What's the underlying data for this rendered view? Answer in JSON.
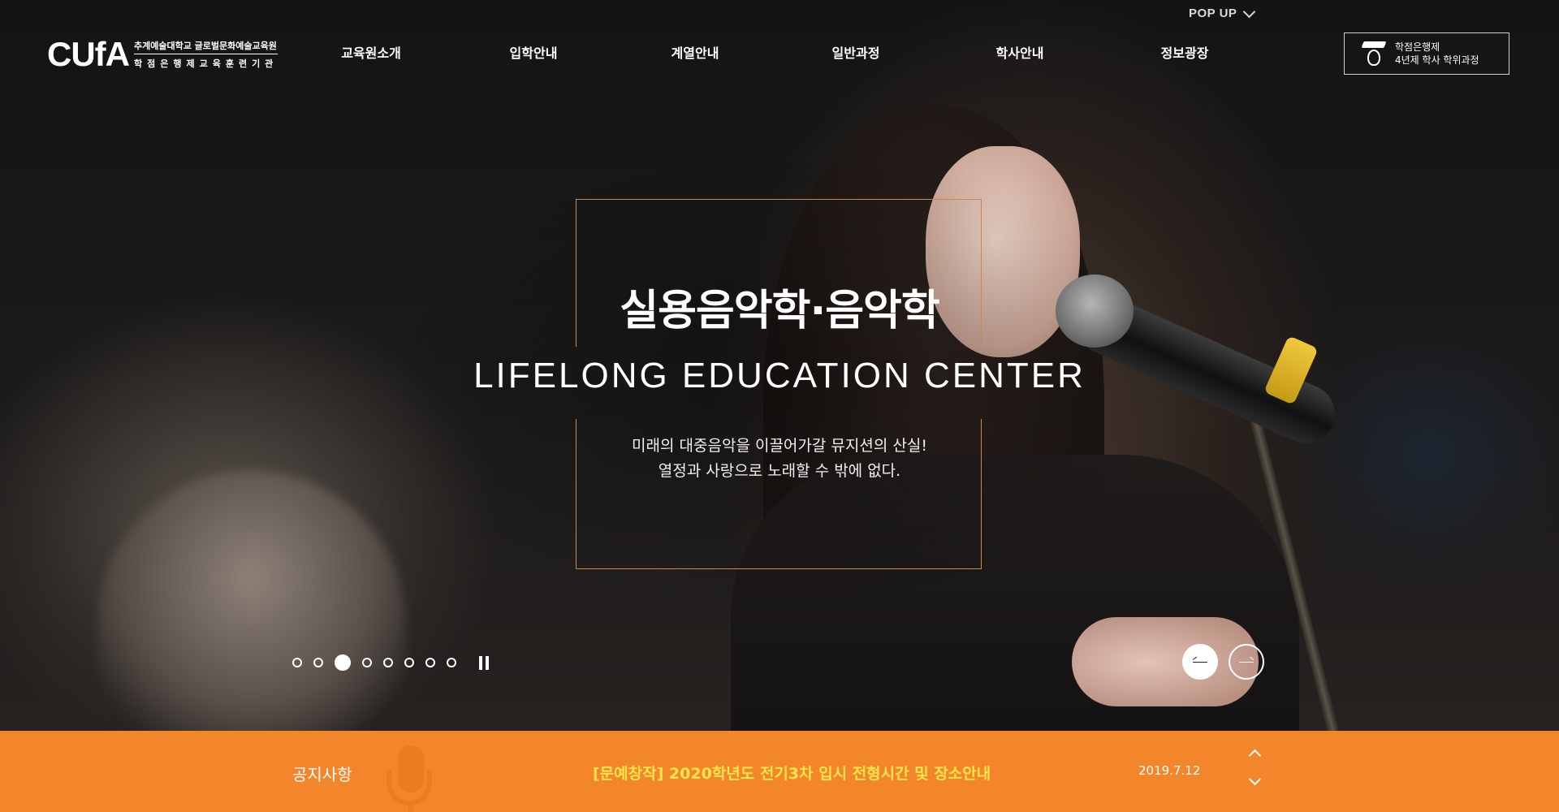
{
  "header": {
    "popup_label": "POP UP",
    "logo": {
      "mark": "CUfA",
      "line1": "추계예술대학교 글로벌문화예술교육원",
      "line2": "학점은행제교육훈련기관"
    },
    "nav": [
      {
        "label": "교육원소개"
      },
      {
        "label": "입학안내"
      },
      {
        "label": "계열안내"
      },
      {
        "label": "일반과정"
      },
      {
        "label": "학사안내"
      },
      {
        "label": "정보광장"
      }
    ],
    "credit_button": {
      "line1": "학점은행제",
      "line2": "4년제 학사 학위과정"
    }
  },
  "hero": {
    "title_ko": "실용음악학·음악학",
    "title_en": "LIFELONG EDUCATION CENTER",
    "subtitle_line1": "미래의 대중음악을 이끌어가갈 뮤지션의 산실!",
    "subtitle_line2": "열정과 사랑으로 노래할 수 밖에 없다.",
    "slides_total": 8,
    "active_slide": 3
  },
  "notice": {
    "label": "공지사항",
    "title": "[문예창작] 2020학년도 전기3차 입시 전형시간 및 장소안내",
    "date": "2019.7.12"
  },
  "colors": {
    "accent": "#f3862a",
    "notice_title": "#fde54a",
    "frame": "#d2864a"
  }
}
